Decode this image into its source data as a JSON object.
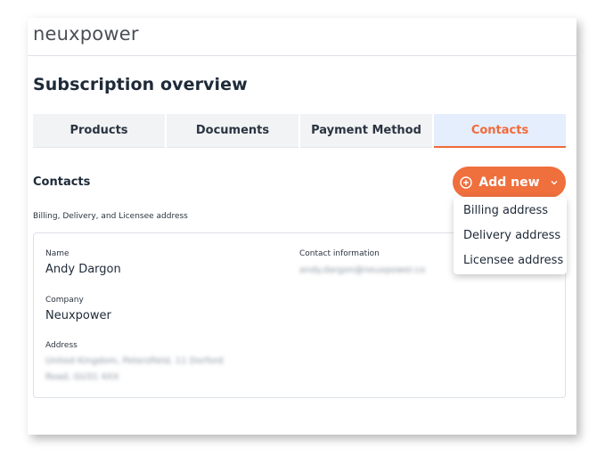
{
  "header": {
    "logo_text": "neuxpower"
  },
  "page": {
    "title": "Subscription overview"
  },
  "tabs": [
    {
      "label": "Products",
      "active": false
    },
    {
      "label": "Documents",
      "active": false
    },
    {
      "label": "Payment Method",
      "active": false
    },
    {
      "label": "Contacts",
      "active": true
    }
  ],
  "contacts": {
    "section_title": "Contacts",
    "subtitle": "Billing, Delivery, and Licensee address",
    "add_button_label": "Add new",
    "add_menu": [
      "Billing address",
      "Delivery address",
      "Licensee address"
    ]
  },
  "contact_card": {
    "name_label": "Name",
    "name_value": "Andy Dargon",
    "contact_info_label": "Contact information",
    "contact_info_value": "andy.dargon@neuxpower.co",
    "company_label": "Company",
    "company_value": "Neuxpower",
    "address_label": "Address",
    "address_line1": "United Kingdom, Petersfield, 11 Dorford",
    "address_line2": "Road, GU31 4XX"
  },
  "colors": {
    "accent": "#ef6f3d",
    "active_tab_bg": "#e5eefc",
    "tab_bg": "#f1f3f5"
  }
}
